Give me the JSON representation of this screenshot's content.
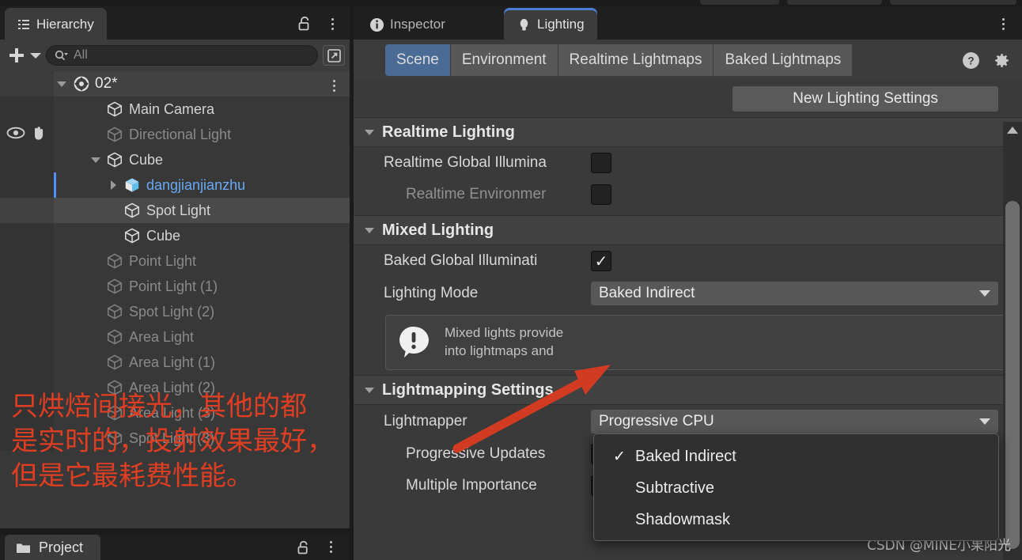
{
  "hierarchy": {
    "tab_label": "Hierarchy",
    "tab_icon": "hierarchy-icon",
    "lock_icon": "lock-open-icon",
    "menu_icon": "kebab-menu-icon",
    "add_label": "+",
    "search_placeholder": "All",
    "search_value": "",
    "expand_icon": "expand-window-icon",
    "scene_root": "02*",
    "items": [
      {
        "label": "Main Camera",
        "depth": 2,
        "state": "normal",
        "twisty": "none",
        "icon": "gameobject-cube-icon"
      },
      {
        "label": "Directional Light",
        "depth": 2,
        "state": "dim",
        "twisty": "none",
        "icon": "gameobject-cube-icon",
        "eye": true,
        "hand": true
      },
      {
        "label": "Cube",
        "depth": 2,
        "state": "normal",
        "twisty": "down",
        "icon": "gameobject-cube-icon"
      },
      {
        "label": "dangjianjianzhu",
        "depth": 3,
        "state": "selected",
        "twisty": "right",
        "icon": "prefab-cube-icon"
      },
      {
        "label": "Spot Light",
        "depth": 3,
        "state": "hover",
        "twisty": "none",
        "icon": "gameobject-cube-icon"
      },
      {
        "label": "Cube",
        "depth": 3,
        "state": "normal",
        "twisty": "none",
        "icon": "gameobject-cube-icon"
      },
      {
        "label": "Point Light",
        "depth": 2,
        "state": "dim",
        "twisty": "none",
        "icon": "gameobject-cube-icon"
      },
      {
        "label": "Point Light (1)",
        "depth": 2,
        "state": "dim",
        "twisty": "none",
        "icon": "gameobject-cube-icon"
      },
      {
        "label": "Spot Light (2)",
        "depth": 2,
        "state": "dim",
        "twisty": "none",
        "icon": "gameobject-cube-icon"
      },
      {
        "label": "Area Light",
        "depth": 2,
        "state": "dim",
        "twisty": "none",
        "icon": "gameobject-cube-icon"
      },
      {
        "label": "Area Light (1)",
        "depth": 2,
        "state": "dim",
        "twisty": "none",
        "icon": "gameobject-cube-icon"
      },
      {
        "label": "Area Light (2)",
        "depth": 2,
        "state": "dim",
        "twisty": "none",
        "icon": "gameobject-cube-icon"
      },
      {
        "label": "Area Light (3)",
        "depth": 2,
        "state": "dim",
        "twisty": "none",
        "icon": "gameobject-cube-icon"
      },
      {
        "label": "Spot Light (3)",
        "depth": 2,
        "state": "dim",
        "twisty": "none",
        "icon": "gameobject-cube-icon"
      }
    ]
  },
  "project": {
    "tab_label": "Project",
    "folder_icon": "folder-icon",
    "lock_icon": "lock-open-icon",
    "menu_icon": "kebab-menu-icon"
  },
  "inspector": {
    "tabs": [
      {
        "label": "Inspector",
        "icon": "info-circle-icon",
        "active": false
      },
      {
        "label": "Lighting",
        "icon": "lightbulb-icon",
        "active": true
      }
    ],
    "menu_icon": "kebab-menu-icon",
    "help_icon": "help-circle-icon",
    "settings_icon": "gear-icon"
  },
  "lighting": {
    "subtabs": [
      {
        "label": "Scene",
        "selected": true
      },
      {
        "label": "Environment",
        "selected": false
      },
      {
        "label": "Realtime Lightmaps",
        "selected": false
      },
      {
        "label": "Baked Lightmaps",
        "selected": false
      }
    ],
    "new_settings_button": "New Lighting Settings",
    "sections": {
      "realtime": {
        "title": "Realtime Lighting",
        "rows": [
          {
            "label": "Realtime Global Illumina",
            "checked": false,
            "dim": false
          },
          {
            "label": "Realtime Environmer",
            "checked": false,
            "dim": true
          }
        ]
      },
      "mixed": {
        "title": "Mixed Lighting",
        "baked_gi_label": "Baked Global Illuminati",
        "baked_gi_checked": true,
        "lighting_mode_label": "Lighting Mode",
        "lighting_mode_value": "Baked Indirect",
        "info_icon": "warning-speech-bubble-icon",
        "info_line1": "Mixed lights provide",
        "info_line2": "into lightmaps and"
      },
      "lightmapping": {
        "title": "Lightmapping Settings",
        "lightmapper_label": "Lightmapper",
        "lightmapper_value": "Progressive CPU",
        "rows": [
          {
            "label": "Progressive Updates",
            "checked": true
          },
          {
            "label": "Multiple Importance",
            "checked": true
          }
        ]
      }
    },
    "lighting_mode_dropdown": {
      "open": true,
      "options": [
        {
          "label": "Baked Indirect",
          "checked": true
        },
        {
          "label": "Subtractive",
          "checked": false
        },
        {
          "label": "Shadowmask",
          "checked": false
        }
      ]
    }
  },
  "annotation": {
    "color": "#df3e22",
    "line1": "只烘焙间接光，其他的都",
    "line2": "是实时的，投射效果最好，",
    "line3": "但是它最耗费性能。",
    "arrow_icon": "red-arrow-icon"
  },
  "watermark": {
    "text": "CSDN @MINE小果阳光"
  },
  "colors": {
    "accent_blue": "#4a7fd4",
    "selected_subtab": "#4a6b96",
    "panel_bg": "#383838",
    "annotation_red": "#df3e22"
  }
}
